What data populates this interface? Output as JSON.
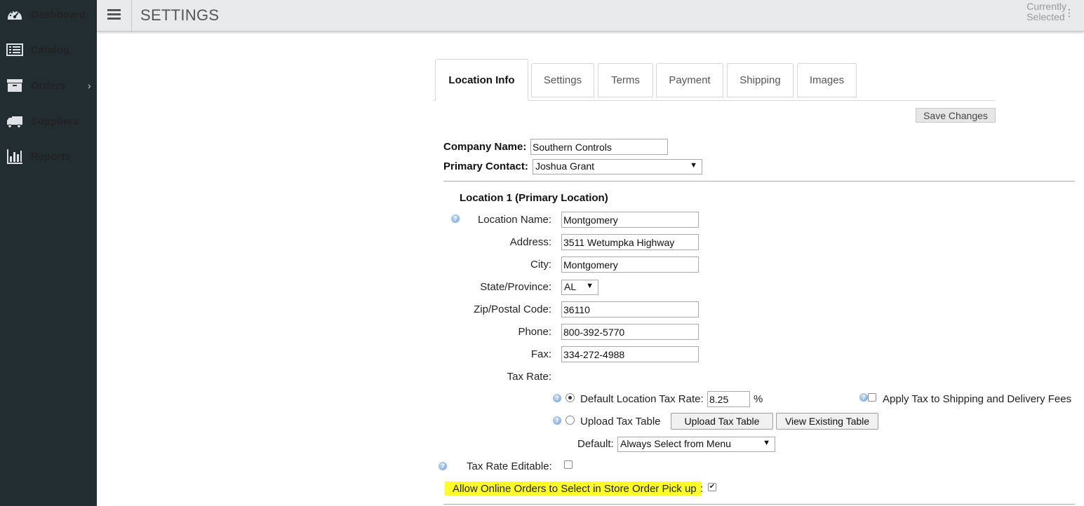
{
  "sidebar": {
    "items": [
      {
        "label": "Dashboard",
        "icon": "dashboard-icon"
      },
      {
        "label": "Catalog",
        "icon": "catalog-icon"
      },
      {
        "label": "Orders",
        "icon": "orders-icon",
        "chevron": "›"
      },
      {
        "label": "Suppliers",
        "icon": "truck-icon"
      },
      {
        "label": "Reports",
        "icon": "bar-chart-icon"
      }
    ]
  },
  "header": {
    "title": "SETTINGS",
    "currently_line1": "Currently",
    "currently_line2": "Selected",
    "menu_icon": "hamburger-icon",
    "kebab_glyph": "⋮"
  },
  "tabs": [
    {
      "label": "Location Info",
      "active": true
    },
    {
      "label": "Settings"
    },
    {
      "label": "Terms"
    },
    {
      "label": "Payment"
    },
    {
      "label": "Shipping"
    },
    {
      "label": "Images"
    }
  ],
  "save_changes_label": "Save Changes",
  "company": {
    "name_label": "Company Name:",
    "name_value": "Southern Controls",
    "contact_label": "Primary Contact:",
    "contact_value": "Joshua Grant"
  },
  "location": {
    "heading": "Location 1 (Primary Location)",
    "name_label": "Location Name:",
    "name_value": "Montgomery",
    "address_label": "Address:",
    "address_value": "3511 Wetumpka Highway",
    "city_label": "City:",
    "city_value": "Montgomery",
    "state_label": "State/Province:",
    "state_value": "AL",
    "zip_label": "Zip/Postal Code:",
    "zip_value": "36110",
    "phone_label": "Phone:",
    "phone_value": "800-392-5770",
    "fax_label": "Fax:",
    "fax_value": "334-272-4988"
  },
  "tax": {
    "rate_label": "Tax Rate:",
    "default_rate_label": "Default Location Tax Rate:",
    "default_rate_value": "8.25",
    "percent": "%",
    "apply_shipping_label": "Apply Tax to Shipping and Delivery Fees",
    "upload_label": "Upload Tax Table",
    "upload_button": "Upload Tax Table",
    "view_button": "View Existing Table",
    "default_label": "Default:",
    "default_value": "Always Select from Menu",
    "editable_label": "Tax Rate Editable:",
    "online_pickup_label": "Allow Online Orders to Select in Store Order Pick up",
    "online_pickup_colon": ":"
  },
  "colors": {
    "sidebar_bg": "#222d32",
    "header_bg": "#e9eaeb",
    "highlight": "#ffff29"
  }
}
